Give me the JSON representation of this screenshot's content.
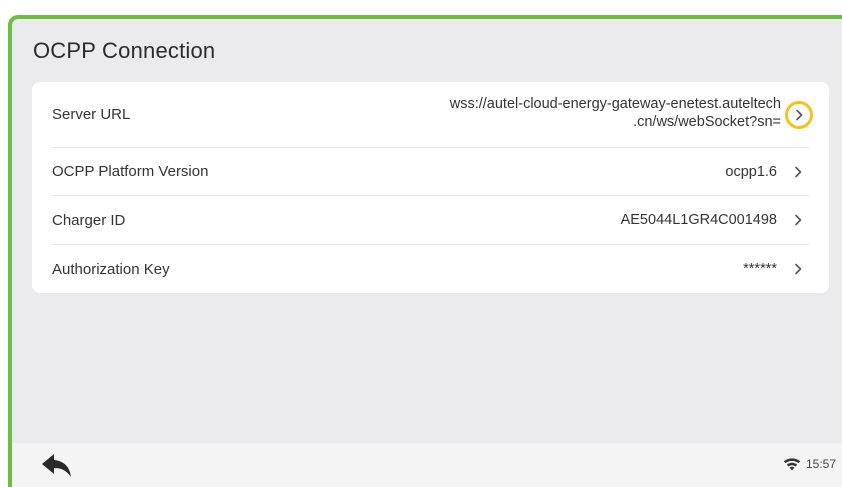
{
  "page": {
    "title": "OCPP Connection"
  },
  "settings": {
    "rows": [
      {
        "label": "Server URL",
        "value_line1": "wss://autel-cloud-energy-gateway-enetest.auteltech",
        "value_line2": ".cn/ws/webSocket?sn="
      },
      {
        "label": "OCPP Platform Version",
        "value": "ocpp1.6"
      },
      {
        "label": "Charger ID",
        "value": "AE5044L1GR4C001498"
      },
      {
        "label": "Authorization Key",
        "value": "******"
      }
    ]
  },
  "status_bar": {
    "time": "15:57"
  },
  "icons": {
    "back": "reply-arrow-icon",
    "chevron": "chevron-right-icon",
    "wifi": "wifi-icon"
  },
  "colors": {
    "accent_border": "#6dbf3f",
    "highlight_ring": "#f2c419",
    "background": "#ebebed",
    "card": "#ffffff"
  }
}
